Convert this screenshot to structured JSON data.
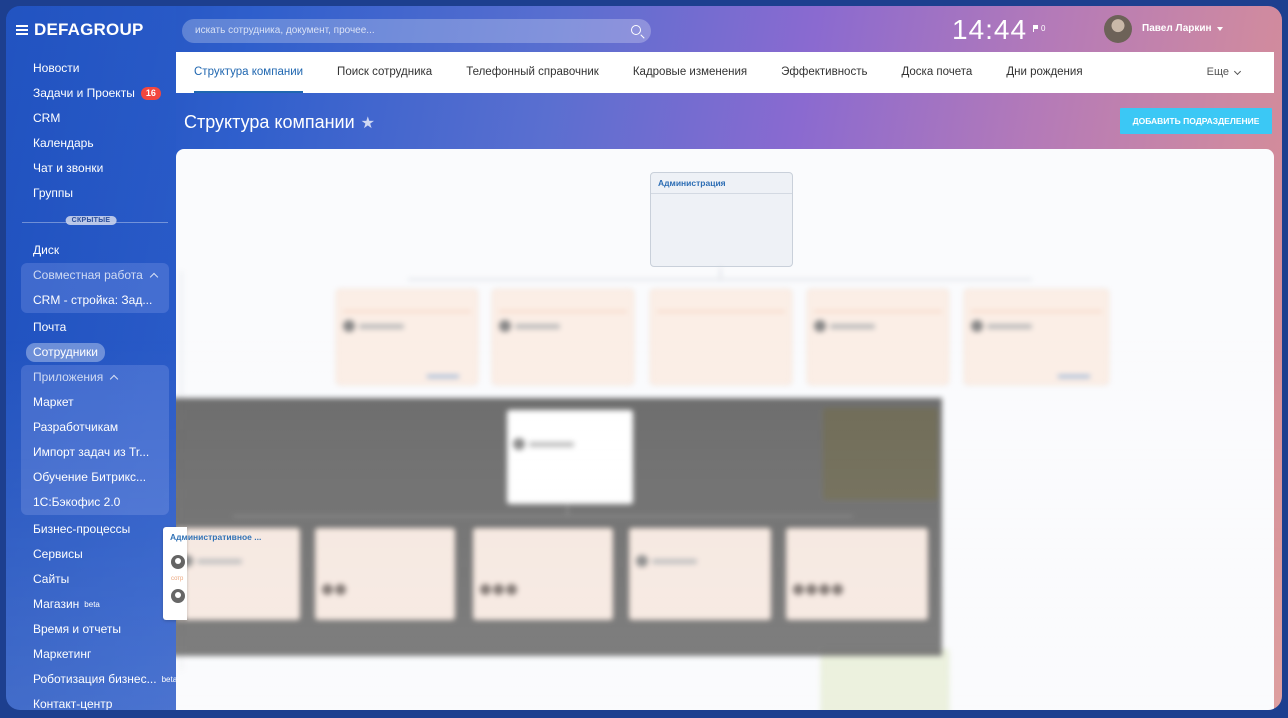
{
  "app": {
    "brand": "DEFAGROUP"
  },
  "search": {
    "placeholder": "искать сотрудника, документ, прочее..."
  },
  "header": {
    "time": "14:44",
    "flag_count": "0",
    "user_name": "Павел Ларкин"
  },
  "sidebar": {
    "items_top": [
      {
        "label": "Новости"
      },
      {
        "label": "Задачи и Проекты",
        "badge": "16"
      },
      {
        "label": "CRM"
      },
      {
        "label": "Календарь"
      },
      {
        "label": "Чат и звонки"
      },
      {
        "label": "Группы"
      }
    ],
    "hidden_label": "СКРЫТЫЕ",
    "disk": "Диск",
    "collab": {
      "title": "Совместная работа",
      "items": [
        "CRM - стройка: Зад..."
      ]
    },
    "mail": "Почта",
    "employees": "Сотрудники",
    "apps": {
      "title": "Приложения",
      "items": [
        "Маркет",
        "Разработчикам",
        "Импорт задач из Tr...",
        "Обучение Битрикс...",
        "1С:Бэкофис 2.0"
      ]
    },
    "items_bottom": [
      {
        "label": "Бизнес-процессы"
      },
      {
        "label": "Сервисы"
      },
      {
        "label": "Сайты"
      },
      {
        "label": "Магазин",
        "beta": "beta"
      },
      {
        "label": "Время и отчеты"
      },
      {
        "label": "Маркетинг"
      },
      {
        "label": "Роботизация бизнес...",
        "beta": "beta"
      },
      {
        "label": "Контакт-центр"
      }
    ]
  },
  "tabs": [
    "Структура компании",
    "Поиск сотрудника",
    "Телефонный справочник",
    "Кадровые изменения",
    "Эффективность",
    "Доска почета",
    "Дни рождения"
  ],
  "tabs_more": "Еще",
  "page": {
    "title": "Структура компании",
    "add_button": "ДОБАВИТЬ ПОДРАЗДЕЛЕНИЕ"
  },
  "org": {
    "root": "Администрация",
    "popup_title": "Административное ...",
    "popup_subtext": "сотр"
  }
}
